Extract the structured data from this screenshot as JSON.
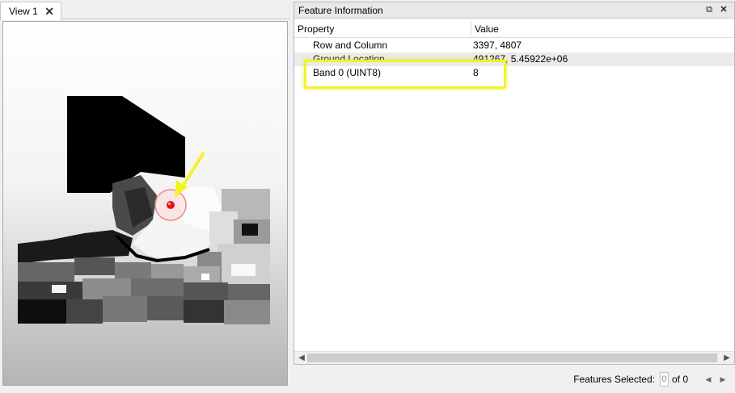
{
  "view": {
    "tab_label": "View 1",
    "tab_close_icon": "close-icon"
  },
  "feature_info": {
    "title": "Feature Information",
    "float_icon": "float-window-icon",
    "close_icon": "close-icon",
    "columns": {
      "property": "Property",
      "value": "Value"
    },
    "rows": [
      {
        "property": "Row and Column",
        "value": "3397, 4807"
      },
      {
        "property": "Ground Location",
        "value": "491267, 5.45922e+06"
      },
      {
        "property": "Band 0 (UINT8)",
        "value": "8"
      }
    ],
    "highlight_color": "#f5f227"
  },
  "footer": {
    "features_selected_label": "Features Selected:",
    "selected_count": "0",
    "of_label": "of 0",
    "prev_icon": "triangle-left-icon",
    "next_icon": "triangle-right-icon"
  },
  "annotation": {
    "arrow_color": "#f5f227",
    "marker_color": "#e0161d"
  }
}
